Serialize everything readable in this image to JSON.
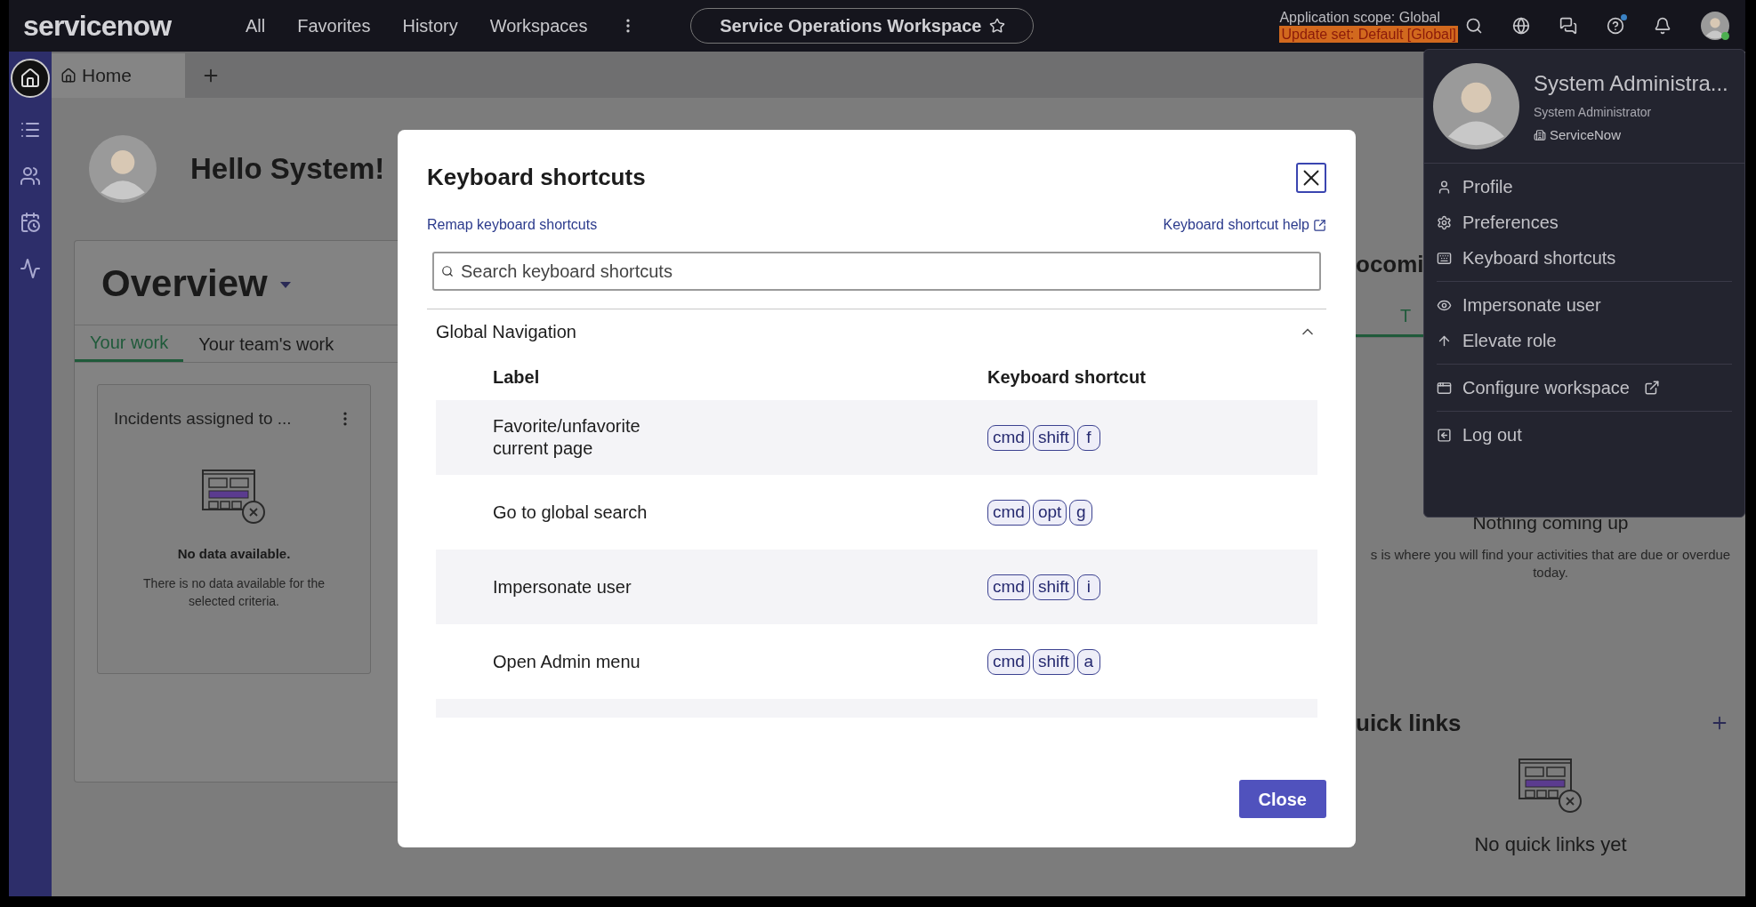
{
  "top_bar": {
    "logo": "servicenow",
    "nav": [
      "All",
      "Favorites",
      "History",
      "Workspaces"
    ],
    "workspace": "Service Operations Workspace",
    "scope": "Application scope: Global",
    "update_set": "Update set: Default [Global]"
  },
  "rail": [
    {
      "kind": "home",
      "selected": true
    },
    {
      "kind": "list",
      "selected": false
    },
    {
      "kind": "people",
      "selected": false
    },
    {
      "kind": "calendar",
      "selected": false
    },
    {
      "kind": "pulse",
      "selected": false
    }
  ],
  "tabs": [
    {
      "label": "Home",
      "selected": true
    }
  ],
  "greeting": "Hello System!",
  "overview": {
    "title": "Overview",
    "tabs": [
      {
        "label": "Your work",
        "selected": true
      },
      {
        "label": "Your team's work",
        "selected": false
      }
    ],
    "card": {
      "title": "Incidents assigned to ...",
      "empty_title": "No data available.",
      "empty_text": "There is no data available for the selected criteria."
    }
  },
  "upcoming": {
    "title": "ocomi",
    "tab": {
      "label": "T",
      "selected": true
    },
    "empty_title": "Nothing coming up",
    "empty_text": "s is where you will find your activities that are due or overdue today."
  },
  "quick_links": {
    "title": "uick links",
    "empty_title": "No quick links yet"
  },
  "dialog": {
    "title": "Keyboard shortcuts",
    "remap_link": "Remap keyboard shortcuts",
    "help_link": "Keyboard shortcut help",
    "search": {
      "placeholder": "Search keyboard shortcuts"
    },
    "section": {
      "title": "Global Navigation",
      "expanded": true,
      "columns": [
        "Label",
        "Keyboard shortcut"
      ],
      "rows": [
        {
          "label": "Favorite/unfavorite current page",
          "keys": [
            "cmd",
            "shift",
            "f"
          ]
        },
        {
          "label": "Go to global search",
          "keys": [
            "cmd",
            "opt",
            "g"
          ]
        },
        {
          "label": "Impersonate user",
          "keys": [
            "cmd",
            "shift",
            "i"
          ]
        },
        {
          "label": "Open Admin menu",
          "keys": [
            "cmd",
            "shift",
            "a"
          ]
        }
      ]
    },
    "close": "Close"
  },
  "user_menu": {
    "name": "System Administra...",
    "role": "System Administrator",
    "company": "ServiceNow",
    "groups": [
      [
        {
          "kind": "profile",
          "label": "Profile"
        },
        {
          "kind": "preferences",
          "label": "Preferences"
        },
        {
          "kind": "keyboard",
          "label": "Keyboard shortcuts"
        }
      ],
      [
        {
          "kind": "impersonate",
          "label": "Impersonate user"
        },
        {
          "kind": "elevate",
          "label": "Elevate role"
        }
      ],
      [
        {
          "kind": "configure",
          "label": "Configure workspace",
          "external": true
        }
      ],
      [
        {
          "kind": "logout",
          "label": "Log out"
        }
      ]
    ]
  }
}
